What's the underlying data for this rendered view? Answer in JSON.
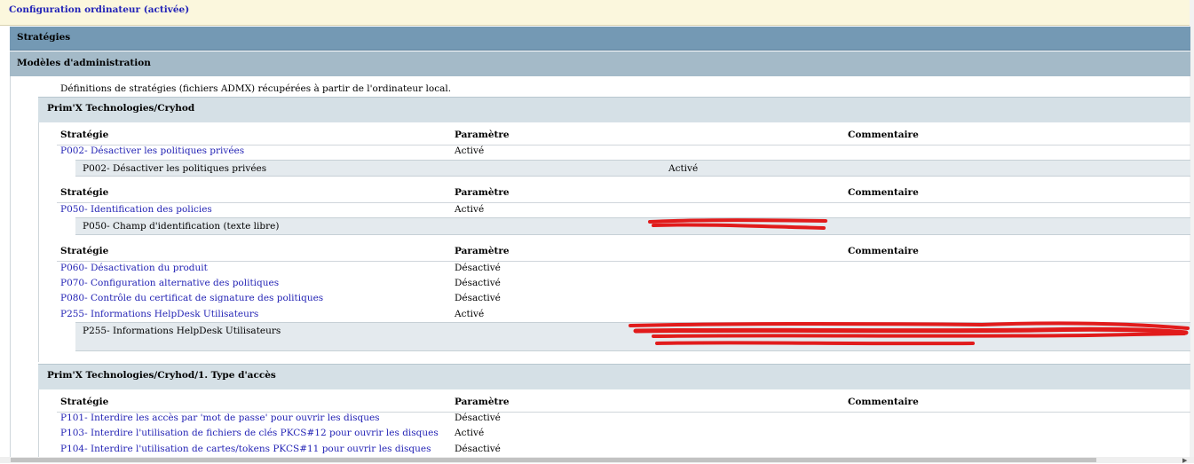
{
  "header": {
    "title": "Configuration ordinateur (activée)"
  },
  "sections": {
    "strategies": "Stratégies",
    "admin_templates": "Modèles d'administration",
    "definitions_note": "Définitions de stratégies (fichiers ADMX) récupérées à partir de l'ordinateur local."
  },
  "columns": {
    "policy": "Stratégie",
    "setting": "Paramètre",
    "comment": "Commentaire"
  },
  "group1": {
    "title": "Prim'X Technologies/Cryhod",
    "t1": {
      "rows": [
        {
          "policy": "P002- Désactiver les politiques privées",
          "setting": "Activé"
        }
      ],
      "detail": {
        "name": "P002- Désactiver les politiques privées",
        "value": "Activé"
      }
    },
    "t2": {
      "rows": [
        {
          "policy": "P050- Identification des policies",
          "setting": "Activé"
        }
      ],
      "detail": {
        "name": "P050- Champ d'identification (texte libre)"
      }
    },
    "t3": {
      "rows": [
        {
          "policy": "P060- Désactivation du produit",
          "setting": "Désactivé"
        },
        {
          "policy": "P070- Configuration alternative des politiques",
          "setting": "Désactivé"
        },
        {
          "policy": "P080- Contrôle du certificat de signature des politiques",
          "setting": "Désactivé"
        },
        {
          "policy": "P255- Informations HelpDesk Utilisateurs",
          "setting": "Activé"
        }
      ],
      "detail": {
        "name": "P255- Informations HelpDesk Utilisateurs"
      }
    }
  },
  "group2": {
    "title": "Prim'X Technologies/Cryhod/1. Type d'accès",
    "rows": [
      {
        "policy": "P101- Interdire les accès par 'mot de passe' pour ouvrir les disques",
        "setting": "Désactivé"
      },
      {
        "policy": "P103- Interdire l'utilisation de fichiers de clés PKCS#12 pour ouvrir les disques",
        "setting": "Activé"
      },
      {
        "policy": "P104- Interdire l'utilisation de cartes/tokens PKCS#11 pour ouvrir les disques",
        "setting": "Désactivé"
      }
    ]
  },
  "redaction_color": "#e11b1b"
}
